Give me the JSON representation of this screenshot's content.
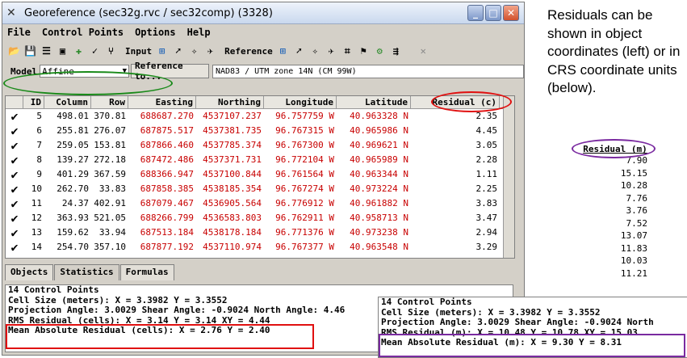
{
  "window": {
    "title": "Georeference (sec32g.rvc / sec32comp) (3328)"
  },
  "menu": [
    "File",
    "Control Points",
    "Options",
    "Help"
  ],
  "toolbar": {
    "input_label": "Input",
    "reference_label": "Reference"
  },
  "model": {
    "label": "Model",
    "value": "Affine",
    "reference_button": "Reference to...",
    "crs": "NAD83 / UTM zone 14N (CM 99W)"
  },
  "table": {
    "headers": [
      "ID",
      "Column",
      "Row",
      "Easting",
      "Northing",
      "Longitude",
      "Latitude",
      "Residual (c)"
    ],
    "rows": [
      [
        "5",
        "498.01",
        "370.81",
        "688687.270",
        "4537107.237",
        "96.757759 W",
        "40.963328 N",
        "2.35"
      ],
      [
        "6",
        "255.81",
        "276.07",
        "687875.517",
        "4537381.735",
        "96.767315 W",
        "40.965986 N",
        "4.45"
      ],
      [
        "7",
        "259.05",
        "153.81",
        "687866.460",
        "4537785.374",
        "96.767300 W",
        "40.969621 N",
        "3.05"
      ],
      [
        "8",
        "139.27",
        "272.18",
        "687472.486",
        "4537371.731",
        "96.772104 W",
        "40.965989 N",
        "2.28"
      ],
      [
        "9",
        "401.29",
        "367.59",
        "688366.947",
        "4537100.844",
        "96.761564 W",
        "40.963344 N",
        "1.11"
      ],
      [
        "10",
        "262.70",
        "33.83",
        "687858.385",
        "4538185.354",
        "96.767274 W",
        "40.973224 N",
        "2.25"
      ],
      [
        "11",
        "24.37",
        "402.91",
        "687079.467",
        "4536905.564",
        "96.776912 W",
        "40.961882 N",
        "3.83"
      ],
      [
        "12",
        "363.93",
        "521.05",
        "688266.799",
        "4536583.803",
        "96.762911 W",
        "40.958713 N",
        "3.47"
      ],
      [
        "13",
        "159.62",
        "33.94",
        "687513.184",
        "4538178.184",
        "96.771376 W",
        "40.973238 N",
        "2.94"
      ],
      [
        "14",
        "254.70",
        "357.10",
        "687877.192",
        "4537110.974",
        "96.767377 W",
        "40.963548 N",
        "3.29"
      ]
    ]
  },
  "tabs": [
    "Objects",
    "Statistics",
    "Formulas"
  ],
  "stats_cells": [
    "14 Control Points",
    "Cell Size (meters):  X = 3.3982  Y = 3.3552",
    "Projection Angle: 3.0029  Shear Angle: -0.9024  North Angle: 4.46",
    "RMS Residual (cells):  X = 3.14  Y = 3.14  XY = 4.44",
    "Mean Absolute Residual (cells):  X = 2.76  Y = 2.40"
  ],
  "stats_meters": [
    "14 Control Points",
    "Cell Size (meters):  X = 3.3982  Y = 3.3552",
    "Projection Angle: 3.0029  Shear Angle: -0.9024  North",
    "RMS Residual (m):  X = 10.48  Y = 10.78  XY = 15.03",
    "Mean Absolute Residual (m):  X = 9.30  Y = 8.31"
  ],
  "caption": "Residuals can be shown in object coordinates (left) or in CRS coordinate units (below).",
  "residual_m": {
    "header": "Residual (m)",
    "values": [
      "7.90",
      "15.15",
      "10.28",
      "7.76",
      "3.76",
      "7.52",
      "13.07",
      "11.83",
      "10.03",
      "11.21"
    ]
  },
  "colors": {
    "highlight_red": "#e01010",
    "highlight_green": "#1a8a1a",
    "highlight_purple": "#7a2aa0",
    "value_red": "#c80000"
  }
}
